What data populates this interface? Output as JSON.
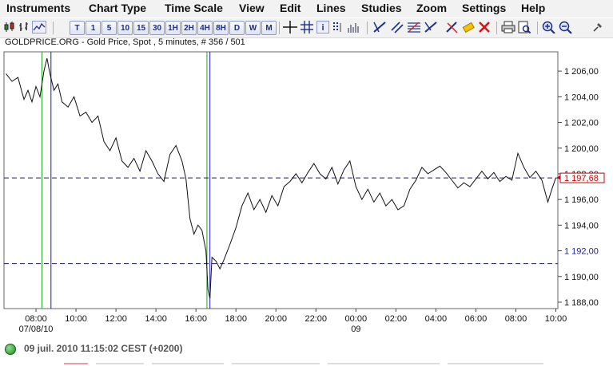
{
  "menu": [
    "Instruments",
    "Chart Type",
    "Time Scale",
    "View",
    "Edit",
    "Lines",
    "Studies",
    "Zoom",
    "Settings",
    "Help"
  ],
  "timeframes": [
    "T",
    "1",
    "5",
    "10",
    "15",
    "30",
    "1H",
    "2H",
    "4H",
    "8H",
    "D",
    "W",
    "M"
  ],
  "toolbar_icons": [
    "candlestick-icon",
    "bar-chart-icon",
    "line-chart-icon",
    "crosshair-icon",
    "info-icon",
    "data-table-icon",
    "volume-icon",
    "trend-line-icon",
    "channel-icon",
    "fibonacci-icon",
    "arrow-line-icon",
    "erase-line-icon",
    "delete-lines-icon",
    "print-icon",
    "print-preview-icon",
    "zoom-in-icon",
    "zoom-out-icon",
    "pin-icon"
  ],
  "chart_info": "GOLDPRICE.ORG - Gold Price, Spot , 5 minutes, # 356 / 501",
  "status_text": "09 juil. 2010 11:15:02  CEST (+0200)",
  "chart_data": {
    "type": "line",
    "title": "",
    "ylim": [
      1187.5,
      1207.5
    ],
    "y_ticks": [
      1188,
      1190,
      1192,
      1194,
      1196,
      1198,
      1200,
      1202,
      1204,
      1206
    ],
    "y_tick_labels": [
      "1 188,00",
      "1 190,00",
      "1 192,00",
      "1 194,00",
      "1 196,00",
      "1 198,00",
      "1 200,00",
      "1 202,00",
      "1 204,00",
      "1 206,00"
    ],
    "x_hours_range": [
      6.4,
      34.1
    ],
    "x_ticks": [
      8,
      10,
      12,
      14,
      16,
      18,
      20,
      22,
      24,
      26,
      28,
      30,
      32,
      34
    ],
    "x_tick_labels": [
      "08:00",
      "10:00",
      "12:00",
      "14:00",
      "16:00",
      "18:00",
      "20:00",
      "22:00",
      "00:00",
      "02:00",
      "04:00",
      "06:00",
      "08:00",
      "10:00"
    ],
    "date_labels": [
      {
        "x": 8,
        "text": "07/08/10"
      },
      {
        "x": 24,
        "text": "09"
      }
    ],
    "current_price": 1197.68,
    "current_price_label": "1 197,68",
    "current_price_color": "#cc0000",
    "hline_level": 1191.0,
    "marked_level_label": "1 192,00",
    "marked_level_color": "#1a1aaa",
    "vlines": [
      {
        "x": 8.3,
        "color": "#2aa02a"
      },
      {
        "x": 8.75,
        "color": "#1a1aaa"
      },
      {
        "x": 16.55,
        "color": "#2aa02a"
      },
      {
        "x": 16.7,
        "color": "#1a1aaa"
      }
    ],
    "x": [
      6.5,
      6.8,
      7.1,
      7.4,
      7.6,
      7.8,
      8.0,
      8.2,
      8.4,
      8.55,
      8.7,
      8.9,
      9.1,
      9.3,
      9.6,
      9.9,
      10.2,
      10.5,
      10.8,
      11.1,
      11.4,
      11.7,
      12.0,
      12.3,
      12.6,
      12.9,
      13.2,
      13.5,
      13.8,
      14.1,
      14.4,
      14.7,
      15.0,
      15.3,
      15.5,
      15.7,
      15.9,
      16.1,
      16.3,
      16.5,
      16.6,
      16.7,
      16.8,
      17.0,
      17.2,
      17.4,
      17.7,
      18.0,
      18.3,
      18.6,
      18.9,
      19.2,
      19.5,
      19.8,
      20.1,
      20.4,
      20.7,
      21.0,
      21.3,
      21.6,
      21.9,
      22.2,
      22.5,
      22.8,
      23.1,
      23.4,
      23.7,
      24.0,
      24.3,
      24.6,
      24.9,
      25.2,
      25.5,
      25.8,
      26.1,
      26.4,
      26.7,
      27.0,
      27.3,
      27.6,
      27.9,
      28.2,
      28.5,
      28.8,
      29.1,
      29.4,
      29.7,
      30.0,
      30.3,
      30.6,
      30.9,
      31.2,
      31.5,
      31.8,
      32.1,
      32.4,
      32.7,
      33.0,
      33.3,
      33.6,
      33.8,
      34.0
    ],
    "y": [
      1205.8,
      1205.2,
      1205.5,
      1203.8,
      1204.5,
      1203.6,
      1204.8,
      1204.0,
      1206.0,
      1207.0,
      1205.8,
      1204.5,
      1205.0,
      1203.6,
      1203.2,
      1204.0,
      1202.5,
      1202.8,
      1202.0,
      1202.5,
      1200.5,
      1199.8,
      1200.8,
      1199.0,
      1198.5,
      1199.2,
      1198.2,
      1199.8,
      1199.0,
      1198.0,
      1197.4,
      1199.5,
      1200.2,
      1199.0,
      1197.6,
      1194.5,
      1193.3,
      1194.0,
      1193.6,
      1192.0,
      1189.0,
      1188.3,
      1191.5,
      1191.2,
      1190.6,
      1191.3,
      1192.5,
      1193.8,
      1195.5,
      1196.5,
      1195.2,
      1196.0,
      1195.0,
      1196.3,
      1195.5,
      1197.0,
      1197.4,
      1198.0,
      1197.3,
      1198.1,
      1198.8,
      1198.0,
      1197.6,
      1198.5,
      1197.2,
      1198.3,
      1199.0,
      1197.0,
      1196.0,
      1196.8,
      1195.8,
      1196.5,
      1195.5,
      1196.0,
      1195.2,
      1195.5,
      1196.8,
      1197.5,
      1198.5,
      1198.0,
      1198.3,
      1198.6,
      1198.1,
      1197.5,
      1196.9,
      1197.3,
      1197.0,
      1197.6,
      1198.2,
      1197.6,
      1198.1,
      1197.4,
      1197.8,
      1197.5,
      1199.6,
      1198.5,
      1197.7,
      1198.2,
      1197.5,
      1195.8,
      1196.8,
      1197.7
    ]
  }
}
